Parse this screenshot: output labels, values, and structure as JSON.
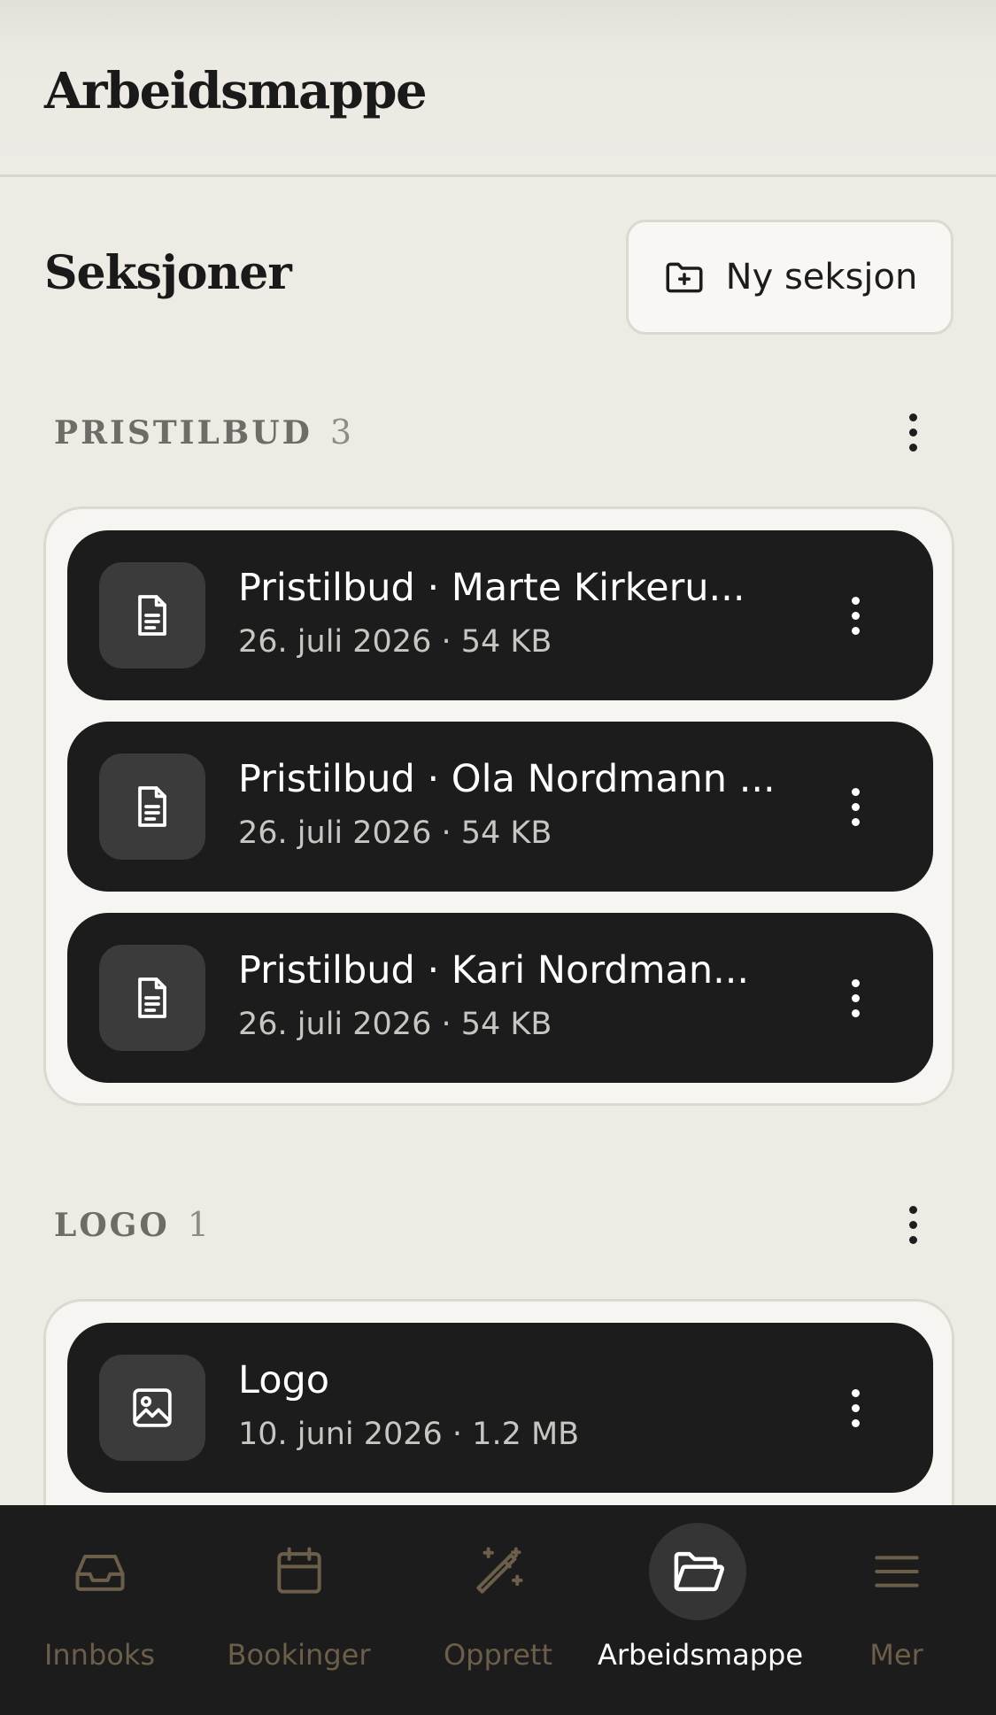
{
  "header": {
    "title": "Arbeidsmappe"
  },
  "sections": {
    "heading": "Seksjoner",
    "new_button": {
      "label": "Ny seksjon",
      "icon": "folder-plus-icon"
    }
  },
  "groups": [
    {
      "name": "PRISTILBUD",
      "count": "3",
      "files": [
        {
          "name": "Pristilbud · Marte Kirkeru...",
          "meta": "26. juli 2026 · 54 KB",
          "icon": "document-icon"
        },
        {
          "name": "Pristilbud · Ola Nordmann ...",
          "meta": "26. juli 2026 · 54 KB",
          "icon": "document-icon"
        },
        {
          "name": "Pristilbud · Kari Nordman...",
          "meta": "26. juli 2026 · 54 KB",
          "icon": "document-icon"
        }
      ]
    },
    {
      "name": "LOGO",
      "count": "1",
      "files": [
        {
          "name": "Logo",
          "meta": "10. juni 2026 · 1.2 MB",
          "icon": "image-icon"
        }
      ]
    }
  ],
  "nav": {
    "items": [
      {
        "label": "Innboks",
        "icon": "inbox-icon",
        "active": false
      },
      {
        "label": "Bookinger",
        "icon": "calendar-icon",
        "active": false
      },
      {
        "label": "Opprett",
        "icon": "magic-wand-icon",
        "active": false
      },
      {
        "label": "Arbeidsmappe",
        "icon": "folder-open-icon",
        "active": true
      },
      {
        "label": "Mer",
        "icon": "menu-icon",
        "active": false
      }
    ]
  },
  "colors": {
    "background": "#edebe4",
    "card": "#1c1c1c",
    "nav_inactive": "#6c5f4a",
    "nav_active": "#ffffff"
  }
}
